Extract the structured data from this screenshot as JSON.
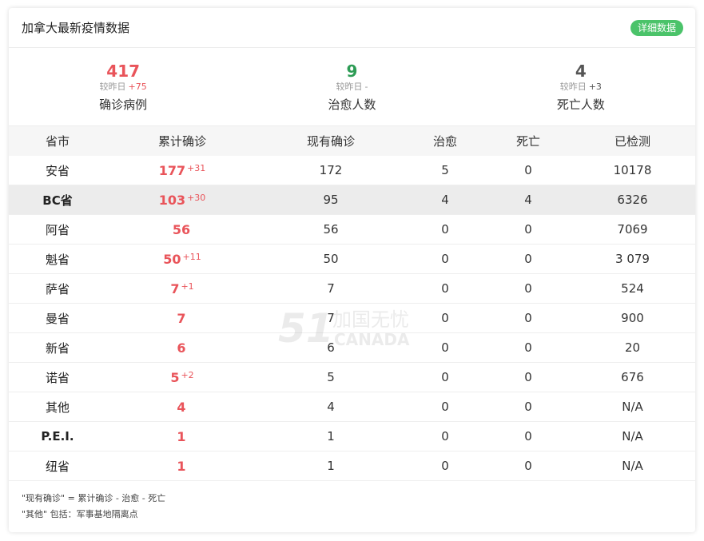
{
  "header": {
    "title": "加拿大最新疫情数据",
    "detail_button": "详细数据"
  },
  "stats": [
    {
      "value": "417",
      "compare_label": "较昨日",
      "delta": "+75",
      "label": "确诊病例",
      "color": "#e9545a"
    },
    {
      "value": "9",
      "compare_label": "较昨日",
      "delta": "-",
      "label": "治愈人数",
      "color": "#2d9c55"
    },
    {
      "value": "4",
      "compare_label": "较昨日",
      "delta": "+3",
      "label": "死亡人数",
      "color": "#555555"
    }
  ],
  "table": {
    "columns": [
      "省市",
      "累计确诊",
      "现有确诊",
      "治愈",
      "死亡",
      "已检测"
    ],
    "rows": [
      {
        "province": "安省",
        "total": "177",
        "inc": "+31",
        "current": "172",
        "cured": "5",
        "dead": "0",
        "tested": "10178"
      },
      {
        "province": "BC省",
        "total": "103",
        "inc": "+30",
        "current": "95",
        "cured": "4",
        "dead": "4",
        "tested": "6326"
      },
      {
        "province": "阿省",
        "total": "56",
        "inc": "",
        "current": "56",
        "cured": "0",
        "dead": "0",
        "tested": "7069"
      },
      {
        "province": "魁省",
        "total": "50",
        "inc": "+11",
        "current": "50",
        "cured": "0",
        "dead": "0",
        "tested": "3 079"
      },
      {
        "province": "萨省",
        "total": "7",
        "inc": "+1",
        "current": "7",
        "cured": "0",
        "dead": "0",
        "tested": "524"
      },
      {
        "province": "曼省",
        "total": "7",
        "inc": "",
        "current": "7",
        "cured": "0",
        "dead": "0",
        "tested": "900"
      },
      {
        "province": "新省",
        "total": "6",
        "inc": "",
        "current": "6",
        "cured": "0",
        "dead": "0",
        "tested": "20"
      },
      {
        "province": "诺省",
        "total": "5",
        "inc": "+2",
        "current": "5",
        "cured": "0",
        "dead": "0",
        "tested": "676"
      },
      {
        "province": "其他",
        "total": "4",
        "inc": "",
        "current": "4",
        "cured": "0",
        "dead": "0",
        "tested": "N/A"
      },
      {
        "province": "P.E.I.",
        "total": "1",
        "inc": "",
        "current": "1",
        "cured": "0",
        "dead": "0",
        "tested": "N/A"
      },
      {
        "province": "纽省",
        "total": "1",
        "inc": "",
        "current": "1",
        "cured": "0",
        "dead": "0",
        "tested": "N/A"
      }
    ]
  },
  "footer": {
    "note1": "\"现有确诊\" = 累计确诊 - 治愈 - 死亡",
    "note2": "\"其他\" 包括：军事基地隔离点"
  },
  "watermark": {
    "number": "51",
    "brand": "加国无忧",
    "sub": "CANADA"
  }
}
